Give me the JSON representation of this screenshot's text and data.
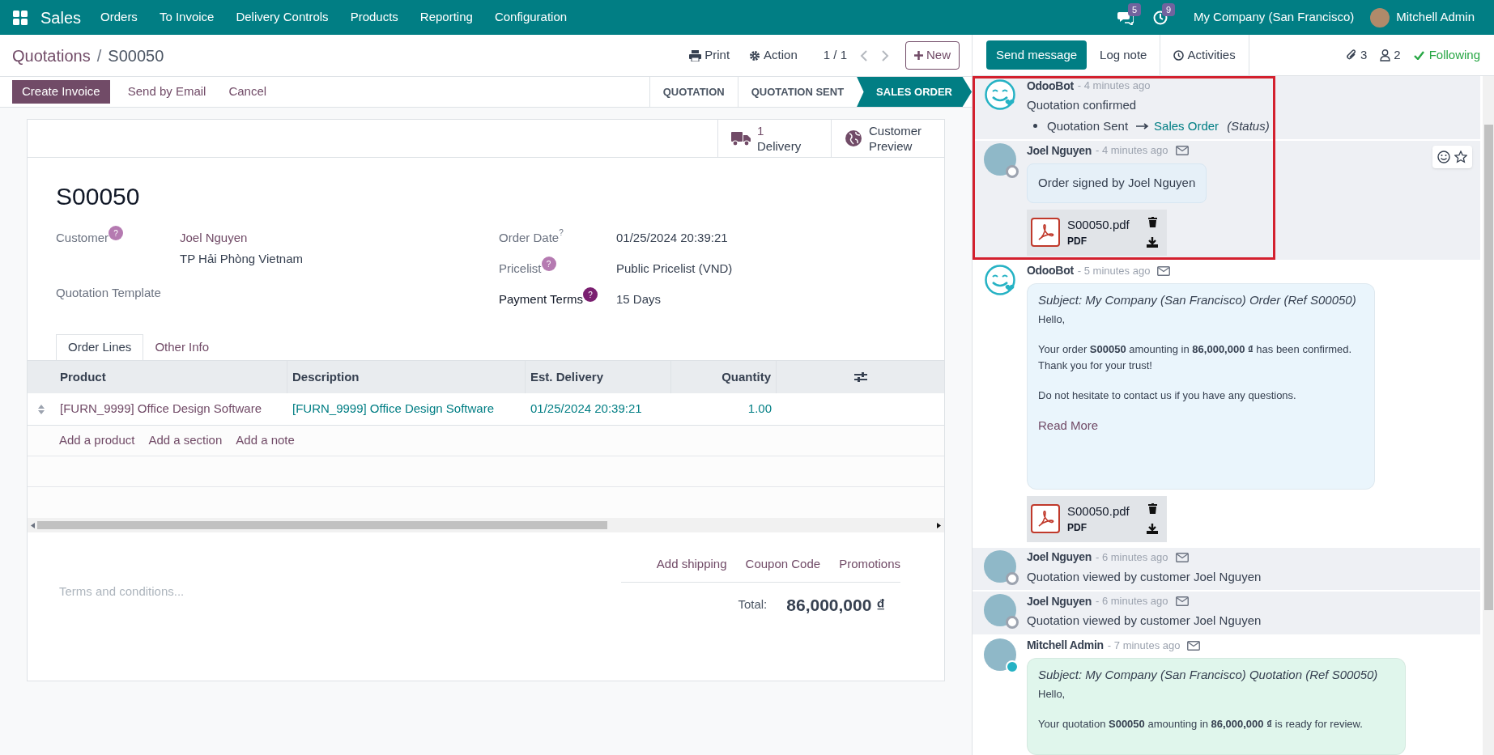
{
  "navbar": {
    "app": "Sales",
    "menu": [
      "Orders",
      "To Invoice",
      "Delivery Controls",
      "Products",
      "Reporting",
      "Configuration"
    ],
    "messages_badge": "5",
    "activities_badge": "9",
    "company": "My Company (San Francisco)",
    "user": "Mitchell Admin"
  },
  "breadcrumb": {
    "parent": "Quotations",
    "separator": "/",
    "current": "S00050"
  },
  "toolbar": {
    "print": "Print",
    "action": "Action",
    "pager": "1 / 1",
    "new": "New"
  },
  "actions": [
    {
      "label": "Create Invoice",
      "primary": true
    },
    {
      "label": "Send by Email",
      "primary": false
    },
    {
      "label": "Cancel",
      "primary": false
    }
  ],
  "statusbar": [
    {
      "label": "QUOTATION",
      "selected": false
    },
    {
      "label": "QUOTATION SENT",
      "selected": false
    },
    {
      "label": "SALES ORDER",
      "selected": true
    }
  ],
  "smart_buttons": [
    {
      "kind": "truck",
      "lines": [
        "1",
        "Delivery"
      ]
    },
    {
      "kind": "globe",
      "lines": [
        "Customer",
        "Preview"
      ]
    }
  ],
  "record": {
    "name": "S00050",
    "left_fields": [
      {
        "label": "Customer",
        "help": "?",
        "kind": "badge",
        "required": false,
        "lines": [
          {
            "text": "Joel Nguyen",
            "link": true
          },
          {
            "text": "TP Hải Phòng Vietnam",
            "link": false
          }
        ]
      },
      {
        "label": "Quotation Template",
        "required": false
      }
    ],
    "right_fields": [
      {
        "label": "Order Date",
        "help": "?",
        "kind": "sup",
        "required": false,
        "lines": [
          {
            "text": "01/25/2024 20:39:21",
            "link": false
          }
        ]
      },
      {
        "label": "Pricelist",
        "help": "?",
        "kind": "badge",
        "required": false,
        "lines": [
          {
            "text": "Public Pricelist (VND)",
            "link": false
          }
        ]
      },
      {
        "label": "Payment Terms",
        "help": "?",
        "kind": "badge",
        "required": true,
        "lines": [
          {
            "text": "15 Days",
            "link": false
          }
        ]
      }
    ]
  },
  "tabs": [
    {
      "label": "Order Lines",
      "selected": true
    },
    {
      "label": "Other Info",
      "selected": false
    }
  ],
  "table": {
    "columns": [
      "Product",
      "Description",
      "Est. Delivery",
      "Quantity"
    ],
    "rows": [
      [
        "[FURN_9999] Office Design Software",
        "[FURN_9999] Office Design Software",
        "01/25/2024 20:39:21",
        "1.00"
      ]
    ],
    "add_links": [
      "Add a product",
      "Add a section",
      "Add a note"
    ]
  },
  "footer": {
    "links": [
      "Add shipping",
      "Coupon Code",
      "Promotions"
    ],
    "terms_placeholder": "Terms and conditions...",
    "total_label": "Total:",
    "total": "86,000,000 ₫"
  },
  "chatter": {
    "tabs": [
      {
        "label": "Send message",
        "selected": true
      },
      {
        "label": "Log note",
        "selected": false
      },
      {
        "label": "Activities",
        "selected": false
      }
    ],
    "attachments": "3",
    "followers": "2",
    "follow": "Following",
    "messages": [
      {
        "kind": "tracking",
        "author": "OdooBot",
        "bot": true,
        "time": "- 4 minutes ago",
        "email": false,
        "shaded": true,
        "highlighted": true,
        "text": "Quotation confirmed",
        "change": {
          "from": "Quotation Sent",
          "to": "Sales Order",
          "field": "(Status)"
        }
      },
      {
        "kind": "comment",
        "author": "Joel Nguyen",
        "bot": false,
        "online": false,
        "time": "- 4 minutes ago",
        "email": true,
        "shaded": true,
        "highlighted": true,
        "reactions": true,
        "text": "Order signed by Joel Nguyen",
        "attachment": {
          "name": "S00050.pdf",
          "type": "PDF"
        }
      },
      {
        "kind": "email",
        "author": "OdooBot",
        "bot": true,
        "time": "- 5 minutes ago",
        "email": true,
        "shaded": false,
        "highlighted": false,
        "color": "#eaf5fc",
        "subject": "Subject: My Company (San Francisco) Order (Ref S00050)",
        "paragraphs": [
          "Hello,",
          "Your order **S00050** amounting in **86,000,000 ₫** has been confirmed.",
          "Thank you for your trust!",
          "Do not hesitate to contact us if you have any questions."
        ],
        "read_more": "Read More",
        "attachment": {
          "name": "S00050.pdf",
          "type": "PDF"
        }
      },
      {
        "kind": "plain",
        "author": "Joel Nguyen",
        "bot": false,
        "online": false,
        "time": "- 6 minutes ago",
        "email": true,
        "shaded": true,
        "highlighted": false,
        "text": "Quotation viewed by customer Joel Nguyen"
      },
      {
        "kind": "plain",
        "author": "Joel Nguyen",
        "bot": false,
        "online": false,
        "time": "- 6 minutes ago",
        "email": true,
        "shaded": true,
        "highlighted": false,
        "text": "Quotation viewed by customer Joel Nguyen"
      },
      {
        "kind": "email",
        "author": "Mitchell Admin",
        "bot": false,
        "online": true,
        "time": "- 7 minutes ago",
        "email": true,
        "shaded": false,
        "highlighted": false,
        "color": "#e0f6ec",
        "subject": "Subject: My Company (San Francisco) Quotation (Ref S00050)",
        "paragraphs": [
          "Hello,",
          "Your quotation **S00050** amounting in **86,000,000 ₫** is ready for review."
        ]
      }
    ]
  }
}
